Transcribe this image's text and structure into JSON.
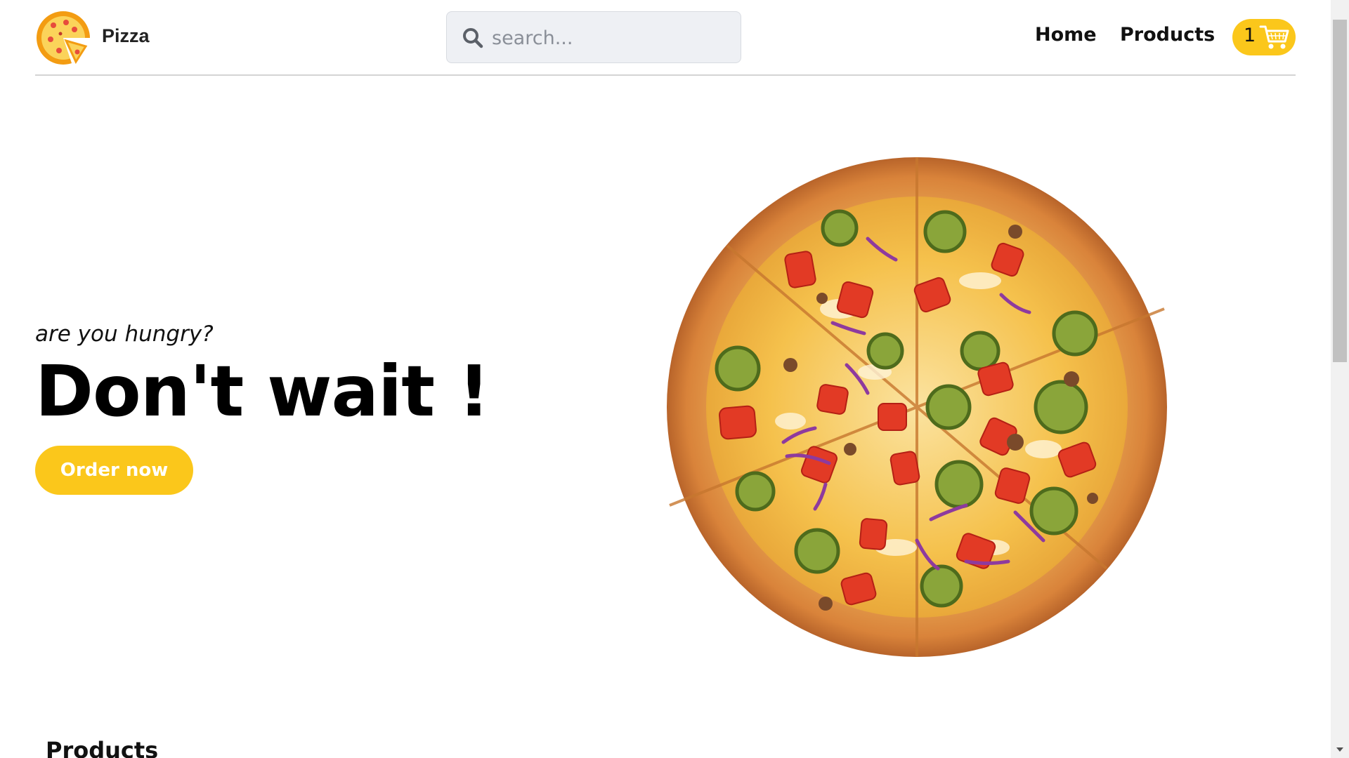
{
  "header": {
    "brand": "Pizza",
    "search": {
      "placeholder": "search...",
      "value": ""
    },
    "nav": {
      "home": "Home",
      "products": "Products"
    },
    "cart": {
      "count": "1"
    }
  },
  "hero": {
    "tagline": "are you hungry?",
    "headline": "Don't wait !",
    "cta_label": "Order now"
  },
  "products_section": {
    "title": "Products"
  },
  "icons": {
    "logo": "pizza-slice-logo",
    "search": "magnifier-icon",
    "cart": "shopping-cart-icon"
  },
  "colors": {
    "accent": "#fbc71b",
    "header_border": "#d4d4d4",
    "search_bg": "#eef0f4"
  }
}
